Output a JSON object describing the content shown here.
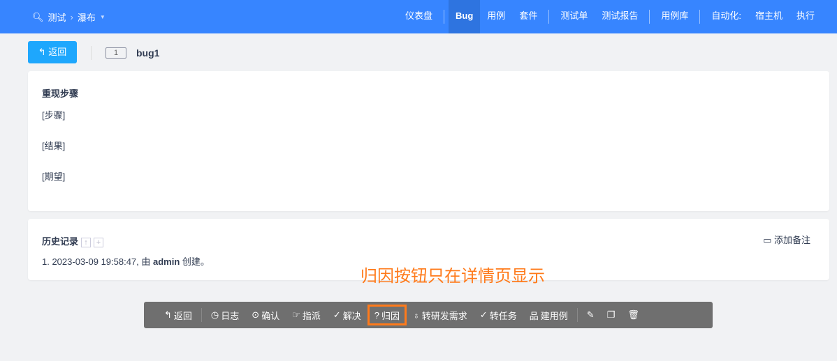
{
  "header": {
    "product": "测试",
    "project": "瀑布",
    "nav": [
      "仪表盘",
      "Bug",
      "用例",
      "套件",
      "测试单",
      "测试报告",
      "用例库",
      "自动化:",
      "宿主机",
      "执行"
    ],
    "active": "Bug"
  },
  "toolbar": {
    "back": "返回",
    "bug_id": "1",
    "bug_title": "bug1"
  },
  "steps": {
    "heading": "重现步骤",
    "lines": [
      "[步骤]",
      "[结果]",
      "[期望]"
    ]
  },
  "history": {
    "heading": "历史记录",
    "add_note": "添加备注",
    "entry_prefix": "1. 2023-03-09 19:58:47, 由 ",
    "entry_user": "admin",
    "entry_suffix": " 创建。"
  },
  "annotation": "归因按钮只在详情页显示",
  "actions": {
    "back": "返回",
    "log": "日志",
    "confirm": "确认",
    "assign": "指派",
    "resolve": "解决",
    "attribute": "归因",
    "to_story": "转研发需求",
    "to_task": "转任务",
    "create_case": "建用例"
  },
  "colors": {
    "header": "#3785ff",
    "highlight": "#ff7a1a",
    "action_bar": "#6f6f6f"
  }
}
